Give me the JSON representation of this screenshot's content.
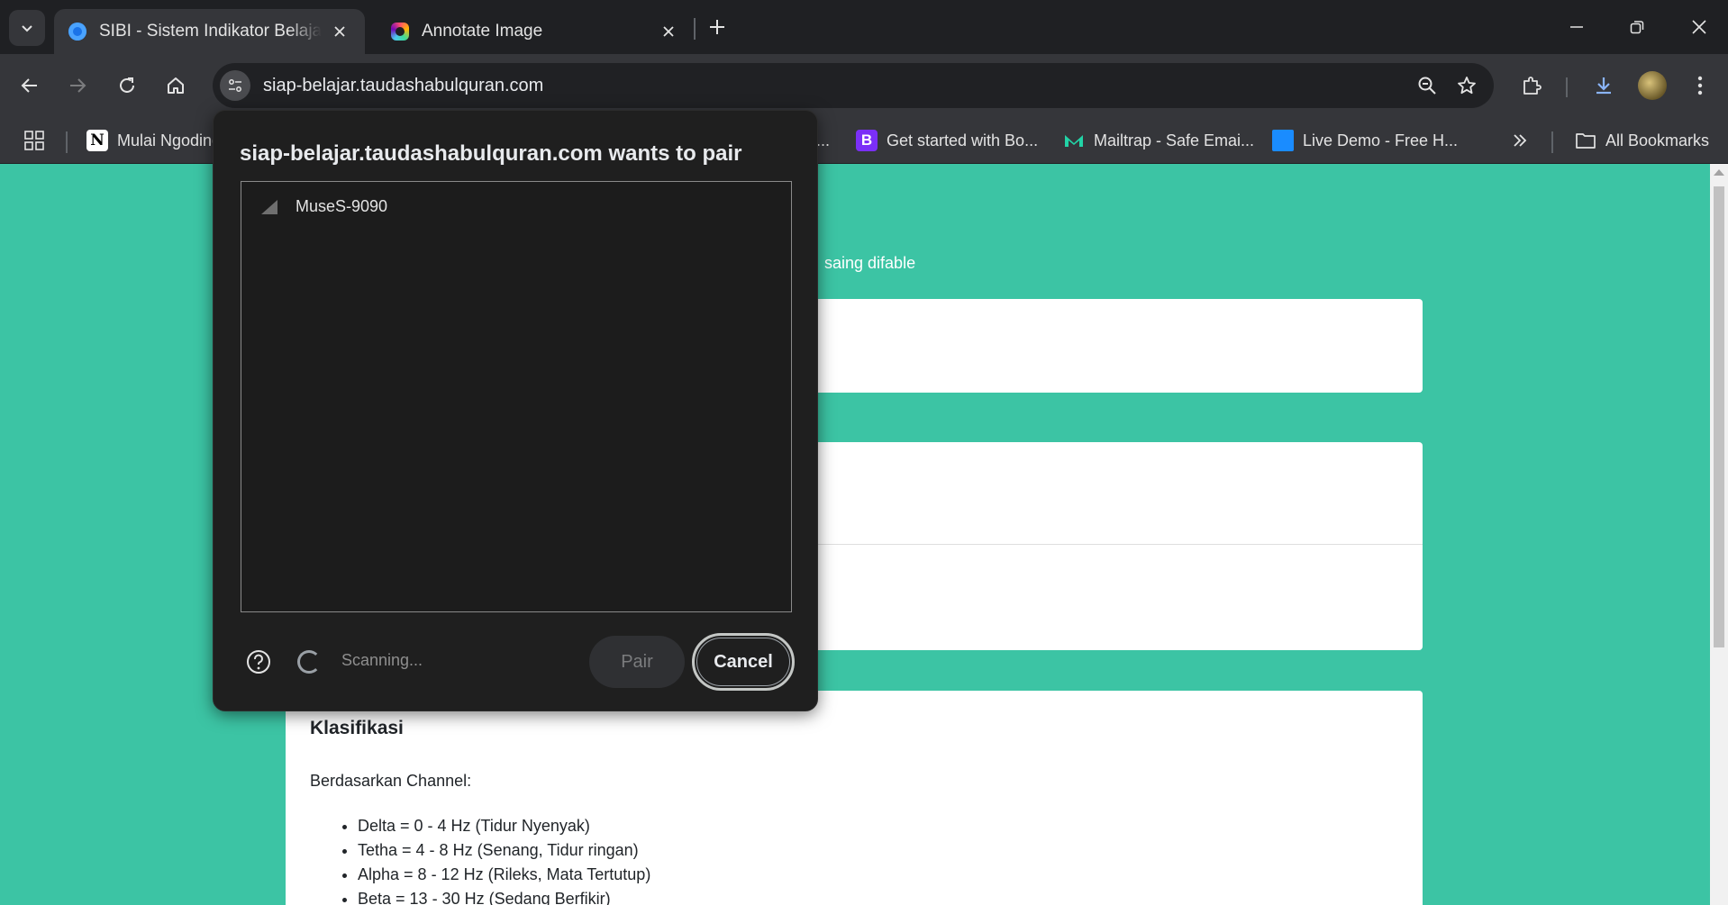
{
  "tabs": [
    {
      "title": "SIBI - Sistem Indikator Belajar Interaktif",
      "active": true,
      "favicon_color": "#1a73e8"
    },
    {
      "title": "Annotate Image",
      "active": false
    }
  ],
  "omnibox": {
    "url": "siap-belajar.taudashabulquran.com"
  },
  "bookmarks": [
    {
      "label": "Mulai Ngoding",
      "icon": "notion-icon"
    },
    {
      "label": "...",
      "icon": ""
    },
    {
      "label": "Get started with Bo...",
      "icon": "bootstrap-icon"
    },
    {
      "label": "Mailtrap - Safe Emai...",
      "icon": "mailtrap-icon"
    },
    {
      "label": "Live Demo - Free H...",
      "icon": "demo-icon"
    },
    {
      "label": "All Bookmarks",
      "icon": "folder-icon"
    }
  ],
  "page": {
    "subtitle_fragment": "saing difable",
    "klasifikasi": {
      "title": "Klasifikasi",
      "subtitle": "Berdasarkan Channel:",
      "items": [
        "Delta = 0 - 4 Hz (Tidur Nyenyak)",
        "Tetha = 4 - 8 Hz (Senang, Tidur ringan)",
        "Alpha = 8 - 12 Hz (Rileks, Mata Tertutup)",
        "Beta = 13 - 30 Hz (Sedang Berfikir)"
      ]
    }
  },
  "dialog": {
    "title": "siap-belajar.taudashabulquran.com wants to pair",
    "devices": [
      "MuseS-9090"
    ],
    "status": "Scanning...",
    "pair_label": "Pair",
    "cancel_label": "Cancel"
  },
  "colors": {
    "page_bg": "#3cc4a4",
    "chrome_dark": "#1f2023",
    "toolbar": "#35363a",
    "dialog_bg": "#1f1f1f"
  }
}
